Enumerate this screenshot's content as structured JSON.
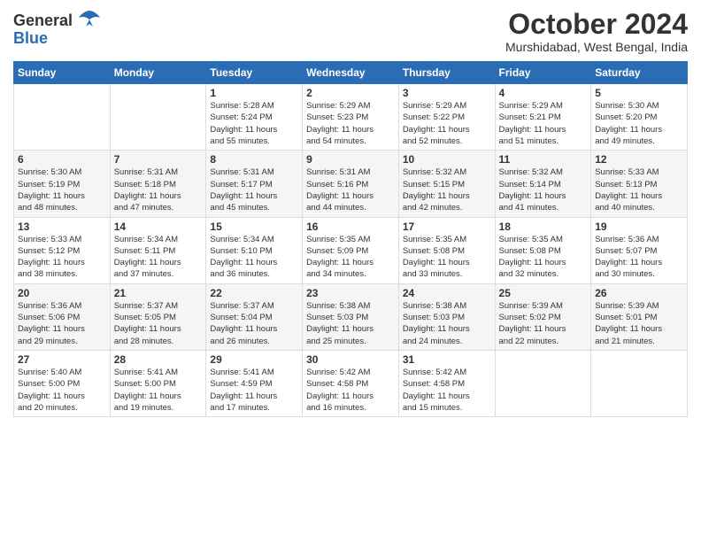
{
  "header": {
    "logo_line1": "General",
    "logo_line2": "Blue",
    "month_title": "October 2024",
    "location": "Murshidabad, West Bengal, India"
  },
  "weekdays": [
    "Sunday",
    "Monday",
    "Tuesday",
    "Wednesday",
    "Thursday",
    "Friday",
    "Saturday"
  ],
  "weeks": [
    [
      {
        "day": "",
        "info": ""
      },
      {
        "day": "",
        "info": ""
      },
      {
        "day": "1",
        "info": "Sunrise: 5:28 AM\nSunset: 5:24 PM\nDaylight: 11 hours\nand 55 minutes."
      },
      {
        "day": "2",
        "info": "Sunrise: 5:29 AM\nSunset: 5:23 PM\nDaylight: 11 hours\nand 54 minutes."
      },
      {
        "day": "3",
        "info": "Sunrise: 5:29 AM\nSunset: 5:22 PM\nDaylight: 11 hours\nand 52 minutes."
      },
      {
        "day": "4",
        "info": "Sunrise: 5:29 AM\nSunset: 5:21 PM\nDaylight: 11 hours\nand 51 minutes."
      },
      {
        "day": "5",
        "info": "Sunrise: 5:30 AM\nSunset: 5:20 PM\nDaylight: 11 hours\nand 49 minutes."
      }
    ],
    [
      {
        "day": "6",
        "info": "Sunrise: 5:30 AM\nSunset: 5:19 PM\nDaylight: 11 hours\nand 48 minutes."
      },
      {
        "day": "7",
        "info": "Sunrise: 5:31 AM\nSunset: 5:18 PM\nDaylight: 11 hours\nand 47 minutes."
      },
      {
        "day": "8",
        "info": "Sunrise: 5:31 AM\nSunset: 5:17 PM\nDaylight: 11 hours\nand 45 minutes."
      },
      {
        "day": "9",
        "info": "Sunrise: 5:31 AM\nSunset: 5:16 PM\nDaylight: 11 hours\nand 44 minutes."
      },
      {
        "day": "10",
        "info": "Sunrise: 5:32 AM\nSunset: 5:15 PM\nDaylight: 11 hours\nand 42 minutes."
      },
      {
        "day": "11",
        "info": "Sunrise: 5:32 AM\nSunset: 5:14 PM\nDaylight: 11 hours\nand 41 minutes."
      },
      {
        "day": "12",
        "info": "Sunrise: 5:33 AM\nSunset: 5:13 PM\nDaylight: 11 hours\nand 40 minutes."
      }
    ],
    [
      {
        "day": "13",
        "info": "Sunrise: 5:33 AM\nSunset: 5:12 PM\nDaylight: 11 hours\nand 38 minutes."
      },
      {
        "day": "14",
        "info": "Sunrise: 5:34 AM\nSunset: 5:11 PM\nDaylight: 11 hours\nand 37 minutes."
      },
      {
        "day": "15",
        "info": "Sunrise: 5:34 AM\nSunset: 5:10 PM\nDaylight: 11 hours\nand 36 minutes."
      },
      {
        "day": "16",
        "info": "Sunrise: 5:35 AM\nSunset: 5:09 PM\nDaylight: 11 hours\nand 34 minutes."
      },
      {
        "day": "17",
        "info": "Sunrise: 5:35 AM\nSunset: 5:08 PM\nDaylight: 11 hours\nand 33 minutes."
      },
      {
        "day": "18",
        "info": "Sunrise: 5:35 AM\nSunset: 5:08 PM\nDaylight: 11 hours\nand 32 minutes."
      },
      {
        "day": "19",
        "info": "Sunrise: 5:36 AM\nSunset: 5:07 PM\nDaylight: 11 hours\nand 30 minutes."
      }
    ],
    [
      {
        "day": "20",
        "info": "Sunrise: 5:36 AM\nSunset: 5:06 PM\nDaylight: 11 hours\nand 29 minutes."
      },
      {
        "day": "21",
        "info": "Sunrise: 5:37 AM\nSunset: 5:05 PM\nDaylight: 11 hours\nand 28 minutes."
      },
      {
        "day": "22",
        "info": "Sunrise: 5:37 AM\nSunset: 5:04 PM\nDaylight: 11 hours\nand 26 minutes."
      },
      {
        "day": "23",
        "info": "Sunrise: 5:38 AM\nSunset: 5:03 PM\nDaylight: 11 hours\nand 25 minutes."
      },
      {
        "day": "24",
        "info": "Sunrise: 5:38 AM\nSunset: 5:03 PM\nDaylight: 11 hours\nand 24 minutes."
      },
      {
        "day": "25",
        "info": "Sunrise: 5:39 AM\nSunset: 5:02 PM\nDaylight: 11 hours\nand 22 minutes."
      },
      {
        "day": "26",
        "info": "Sunrise: 5:39 AM\nSunset: 5:01 PM\nDaylight: 11 hours\nand 21 minutes."
      }
    ],
    [
      {
        "day": "27",
        "info": "Sunrise: 5:40 AM\nSunset: 5:00 PM\nDaylight: 11 hours\nand 20 minutes."
      },
      {
        "day": "28",
        "info": "Sunrise: 5:41 AM\nSunset: 5:00 PM\nDaylight: 11 hours\nand 19 minutes."
      },
      {
        "day": "29",
        "info": "Sunrise: 5:41 AM\nSunset: 4:59 PM\nDaylight: 11 hours\nand 17 minutes."
      },
      {
        "day": "30",
        "info": "Sunrise: 5:42 AM\nSunset: 4:58 PM\nDaylight: 11 hours\nand 16 minutes."
      },
      {
        "day": "31",
        "info": "Sunrise: 5:42 AM\nSunset: 4:58 PM\nDaylight: 11 hours\nand 15 minutes."
      },
      {
        "day": "",
        "info": ""
      },
      {
        "day": "",
        "info": ""
      }
    ]
  ]
}
